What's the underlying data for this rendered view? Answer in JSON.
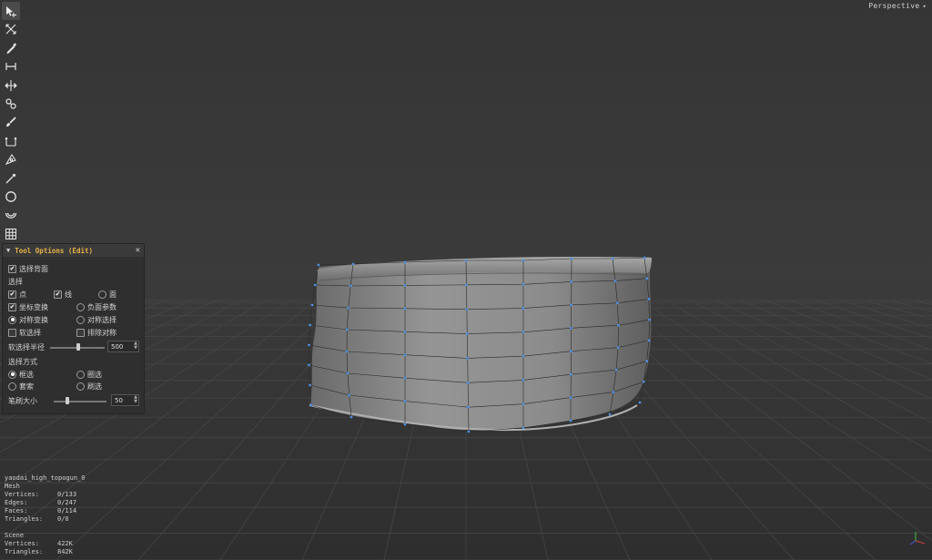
{
  "viewport": {
    "camera_label": "Perspective",
    "camera_caret": "▾"
  },
  "toolbar": {
    "tools": [
      {
        "icon": "select-arrow-icon",
        "active": true
      },
      {
        "icon": "transform-icon"
      },
      {
        "icon": "paint-pencil-icon"
      },
      {
        "icon": "measure-icon"
      },
      {
        "icon": "move-icon"
      },
      {
        "icon": "chain-link-icon"
      },
      {
        "icon": "brush-icon"
      },
      {
        "icon": "scale-icon"
      },
      {
        "icon": "pen-nib-icon"
      },
      {
        "icon": "knife-icon"
      },
      {
        "icon": "circle-icon"
      },
      {
        "icon": "bowl-icon"
      },
      {
        "icon": "grid-icon"
      }
    ]
  },
  "tool_options": {
    "title": "Tool Options (Edit)",
    "collapse_icon": "▼",
    "close_icon": "✕",
    "select_back": {
      "label": "选择背面",
      "checked": true
    },
    "select_section": "选择",
    "point": {
      "label": "点",
      "checked": true
    },
    "line": {
      "label": "线",
      "checked": true
    },
    "face": {
      "label": "面",
      "checked": false
    },
    "coord_transform": {
      "label": "坐标变换",
      "checked": true
    },
    "negative_param": {
      "label": "负面参数",
      "checked": false
    },
    "sym_transform": {
      "label": "对称变换",
      "selected": true
    },
    "sym_select": {
      "label": "对称选择",
      "selected": false
    },
    "soft_select": {
      "label": "软选择",
      "checked": false
    },
    "exclude_sym": {
      "label": "排除对称",
      "checked": false
    },
    "soft_radius": {
      "label": "软选择半径",
      "value": "500",
      "slider_fraction": 0.52
    },
    "select_mode_section": "选择方式",
    "box_select": {
      "label": "框选",
      "selected": true
    },
    "circle_select": {
      "label": "圈选",
      "selected": false
    },
    "lasso": {
      "label": "套索",
      "selected": false
    },
    "brush_select": {
      "label": "刷选",
      "selected": false
    },
    "brush_size": {
      "label": "笔刷大小",
      "value": "50",
      "slider_fraction": 0.25
    }
  },
  "stats": {
    "object_name": "yaodai_high_topogun_0",
    "type": "Mesh",
    "mesh": [
      {
        "k": "Vertices:",
        "v": "0/133"
      },
      {
        "k": "Edges:",
        "v": "0/247"
      },
      {
        "k": "Faces:",
        "v": "0/114"
      },
      {
        "k": "Triangles:",
        "v": "0/0"
      }
    ],
    "scene_label": "Scene",
    "scene": [
      {
        "k": "Vertices:",
        "v": "422K"
      },
      {
        "k": "Triangles:",
        "v": "842K"
      }
    ]
  },
  "colors": {
    "vertex": "#4d8fe0",
    "mesh": "#8a8a8a",
    "panel_title": "#e8b34a"
  }
}
